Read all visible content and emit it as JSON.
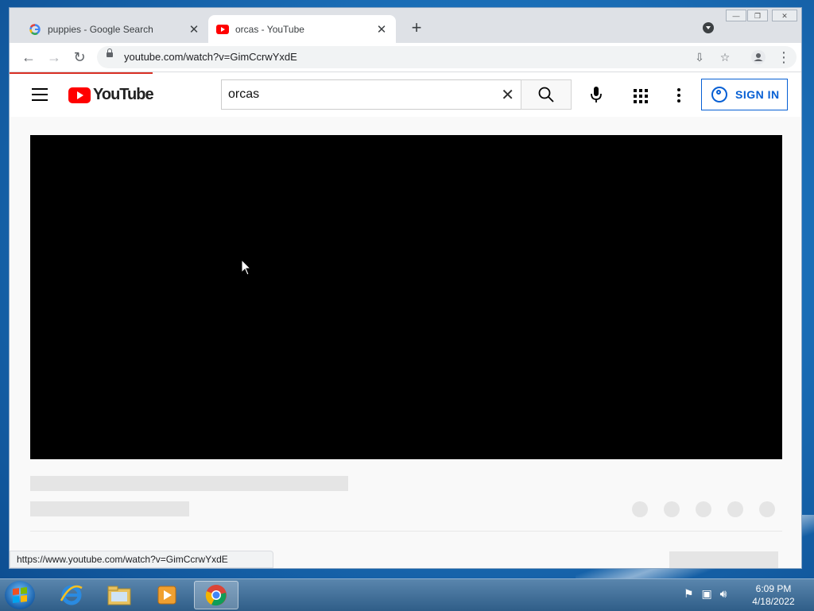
{
  "browser": {
    "tabs": [
      {
        "title": "puppies - Google Search",
        "favicon": "google-icon",
        "active": false
      },
      {
        "title": "orcas - YouTube",
        "favicon": "youtube-icon",
        "active": true
      }
    ],
    "url": "youtube.com/watch?v=GimCcrwYxdE",
    "status_url": "https://www.youtube.com/watch?v=GimCcrwYxdE",
    "icons": [
      "back-icon",
      "forward-icon",
      "reload-icon",
      "lock-icon",
      "install-icon",
      "star-icon",
      "profile-icon",
      "menu-icon"
    ]
  },
  "youtube": {
    "logo_text": "YouTube",
    "search_value": "orcas",
    "signin_label": "SIGN IN",
    "brand_color": "#ff0000",
    "accent_color": "#065fd4"
  },
  "taskbar": {
    "time": "6:09 PM",
    "date": "4/18/2022",
    "apps": [
      "internet-explorer-icon",
      "file-explorer-icon",
      "media-player-icon",
      "chrome-icon"
    ]
  }
}
